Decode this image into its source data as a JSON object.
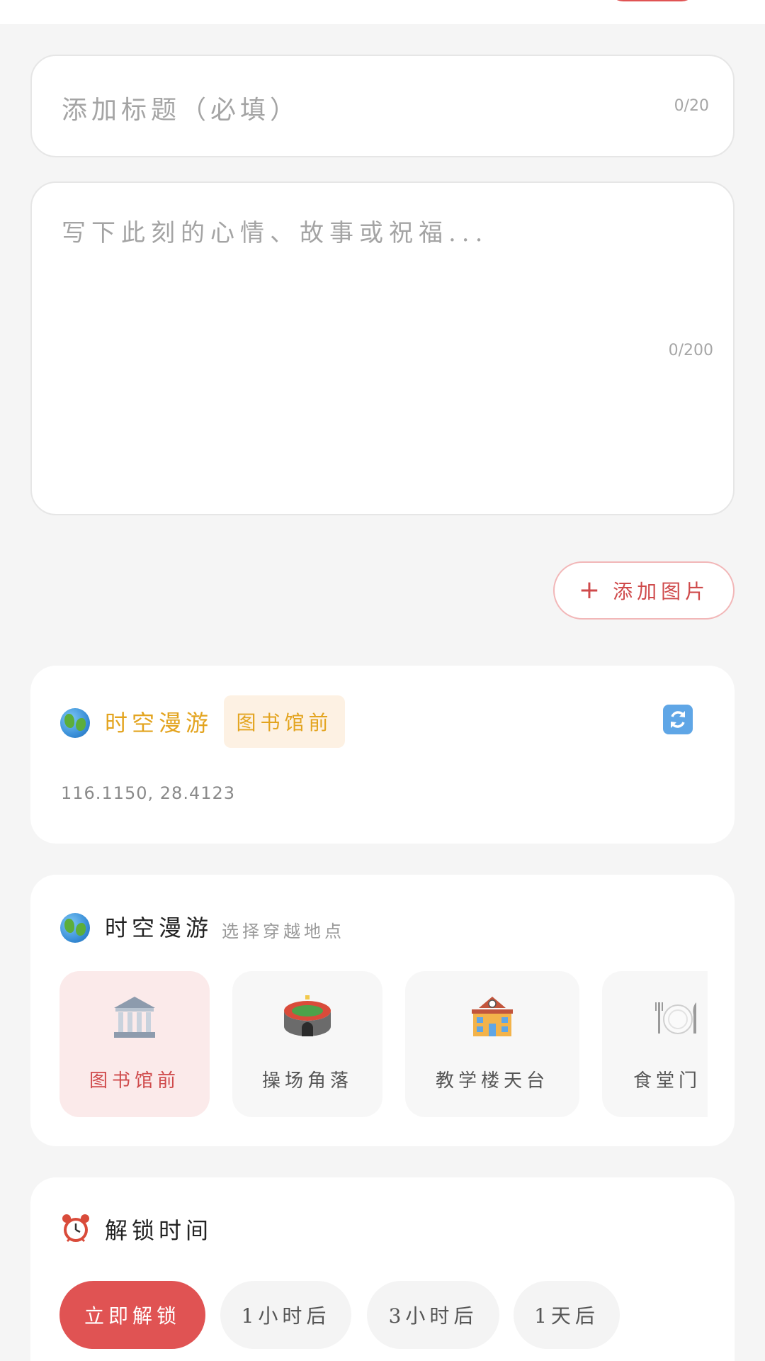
{
  "colors": {
    "accent": "#e05353",
    "accent_text": "#cf4a4b",
    "location_gold": "#e3a41f",
    "card_bg": "#ffffff",
    "page_bg": "#f5f5f5"
  },
  "title_field": {
    "placeholder": "添加标题（必填）",
    "value": "",
    "counter": "0/20"
  },
  "content_field": {
    "placeholder": "写下此刻的心情、故事或祝福...",
    "value": "",
    "counter": "0/200"
  },
  "add_image": {
    "icon": "plus-icon",
    "label": "添加图片"
  },
  "location_summary": {
    "icon": "globe-icon",
    "title": "时空漫游",
    "selected_tag": "图书馆前",
    "refresh_icon": "refresh-icon",
    "coordinates": "116.1150, 28.4123"
  },
  "location_picker": {
    "icon": "globe-icon",
    "title": "时空漫游",
    "subtitle": "选择穿越地点",
    "options": [
      {
        "icon": "library-icon",
        "label": "图书馆前",
        "selected": true
      },
      {
        "icon": "stadium-icon",
        "label": "操场角落",
        "selected": false
      },
      {
        "icon": "school-icon",
        "label": "教学楼天台",
        "selected": false
      },
      {
        "icon": "dining-icon",
        "label": "食堂门",
        "selected": false
      }
    ]
  },
  "unlock_time": {
    "icon": "alarm-clock-icon",
    "title": "解锁时间",
    "options": [
      {
        "label": "立即解锁",
        "active": true
      },
      {
        "label": "1小时后",
        "active": false
      },
      {
        "label": "3小时后",
        "active": false
      },
      {
        "label": "1天后",
        "active": false
      }
    ]
  }
}
